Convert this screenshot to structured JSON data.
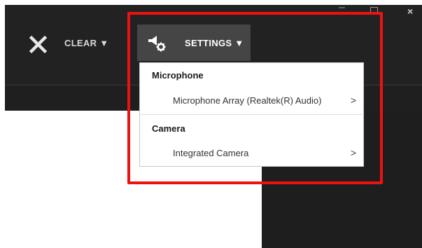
{
  "window": {
    "minimize_glyph": "–",
    "close_glyph": "×"
  },
  "toolbar": {
    "clear_label": "CLEAR ▼",
    "settings_label": "SETTINGS ▼",
    "icons": {
      "clear": "close-x-icon",
      "settings": "speaker-gear-icon"
    }
  },
  "menu": {
    "sections": [
      {
        "header": "Microphone",
        "item": "Microphone Array (Realtek(R) Audio)"
      },
      {
        "header": "Camera",
        "item": "Integrated Camera"
      }
    ],
    "chevron": ">"
  },
  "colors": {
    "toolbar": "#222222",
    "settings_button": "#454545",
    "highlight": "#ee1111"
  }
}
